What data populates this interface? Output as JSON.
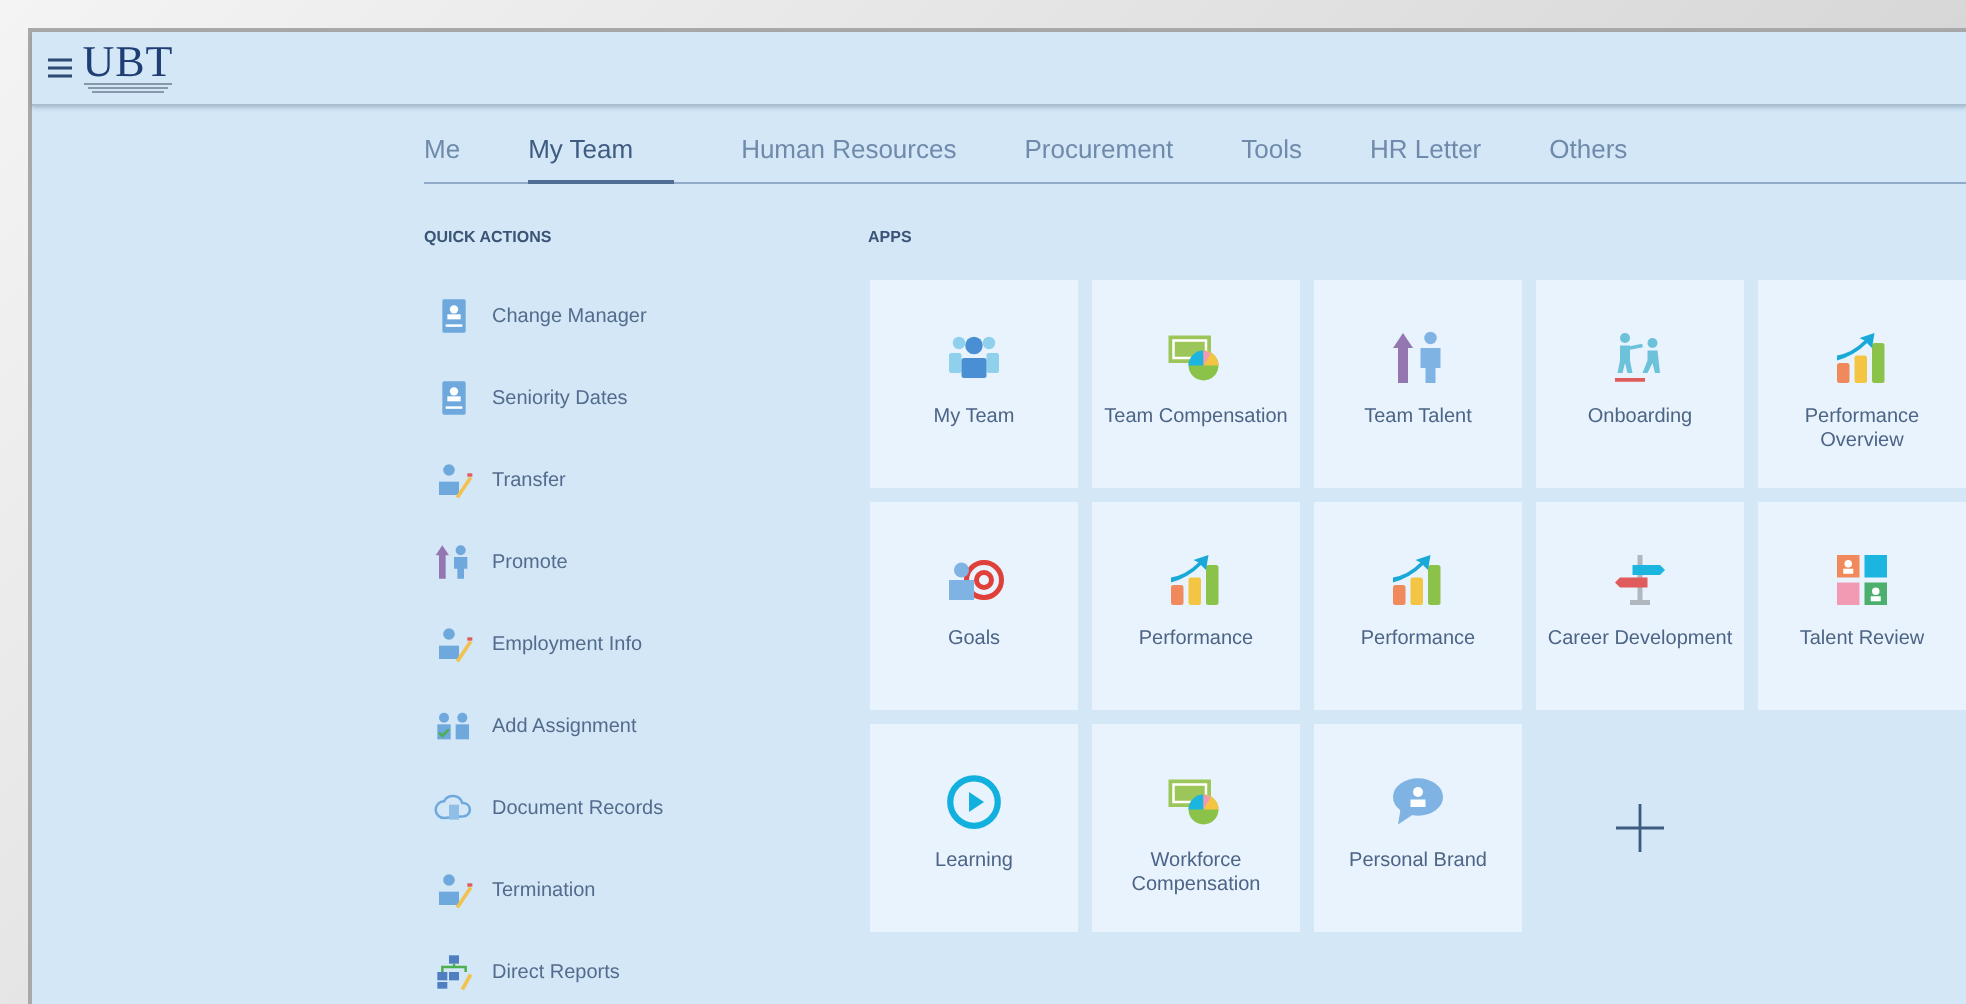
{
  "header": {
    "logo": "UBT"
  },
  "tabs": [
    {
      "label": "Me",
      "selected": false
    },
    {
      "label": "My Team",
      "selected": true
    },
    {
      "label": "Human Resources",
      "selected": false
    },
    {
      "label": "Procurement",
      "selected": false
    },
    {
      "label": "Tools",
      "selected": false
    },
    {
      "label": "HR Letter",
      "selected": false
    },
    {
      "label": "Others",
      "selected": false
    }
  ],
  "quick_actions": {
    "title": "QUICK ACTIONS",
    "items": [
      "Change Manager",
      "Seniority Dates",
      "Transfer",
      "Promote",
      "Employment Info",
      "Add Assignment",
      "Document Records",
      "Termination",
      "Direct Reports"
    ]
  },
  "apps": {
    "title": "APPS",
    "tiles": [
      {
        "kind": "app",
        "label": "My Team"
      },
      {
        "kind": "app",
        "label": "Team Compensation"
      },
      {
        "kind": "app",
        "label": "Team Talent"
      },
      {
        "kind": "app",
        "label": "Onboarding"
      },
      {
        "kind": "app",
        "label": "Performance Overview"
      },
      {
        "kind": "app",
        "label": "Goals"
      },
      {
        "kind": "app",
        "label": "Performance"
      },
      {
        "kind": "app",
        "label": "Performance"
      },
      {
        "kind": "app",
        "label": "Career Development"
      },
      {
        "kind": "app",
        "label": "Talent Review"
      },
      {
        "kind": "app",
        "label": "Learning"
      },
      {
        "kind": "app",
        "label": "Workforce Compensation"
      },
      {
        "kind": "app",
        "label": "Personal Brand"
      },
      {
        "kind": "add"
      }
    ]
  }
}
